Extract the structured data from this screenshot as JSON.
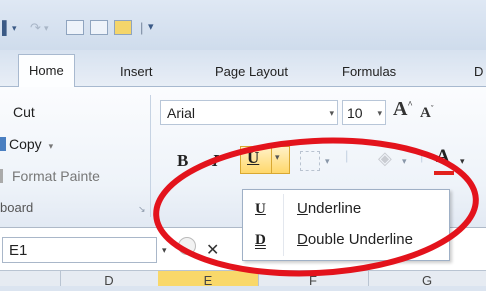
{
  "ribbon_tabs": [
    "Home",
    "Insert",
    "Page Layout",
    "Formulas",
    "D"
  ],
  "clipboard": {
    "cut": "Cut",
    "copy": "Copy",
    "format_painter": "Format Painte",
    "group_label": "board"
  },
  "font": {
    "name": "Arial",
    "size": "10"
  },
  "format_buttons": {
    "bold": "B",
    "italic": "I",
    "underline": "U",
    "font_color_glyph": "A"
  },
  "underline_menu": [
    {
      "icon": "U",
      "label": "Underline",
      "accelerator": "U"
    },
    {
      "icon": "D",
      "label": "Double Underline",
      "accelerator": "D"
    }
  ],
  "name_box": "E1",
  "formula_cancel": "✕",
  "columns": [
    "D",
    "E",
    "F",
    "G"
  ],
  "colors": {
    "annotation": "#e3131c",
    "selected_column": "#f9d86a",
    "font_color_bar": "#e2211c"
  }
}
